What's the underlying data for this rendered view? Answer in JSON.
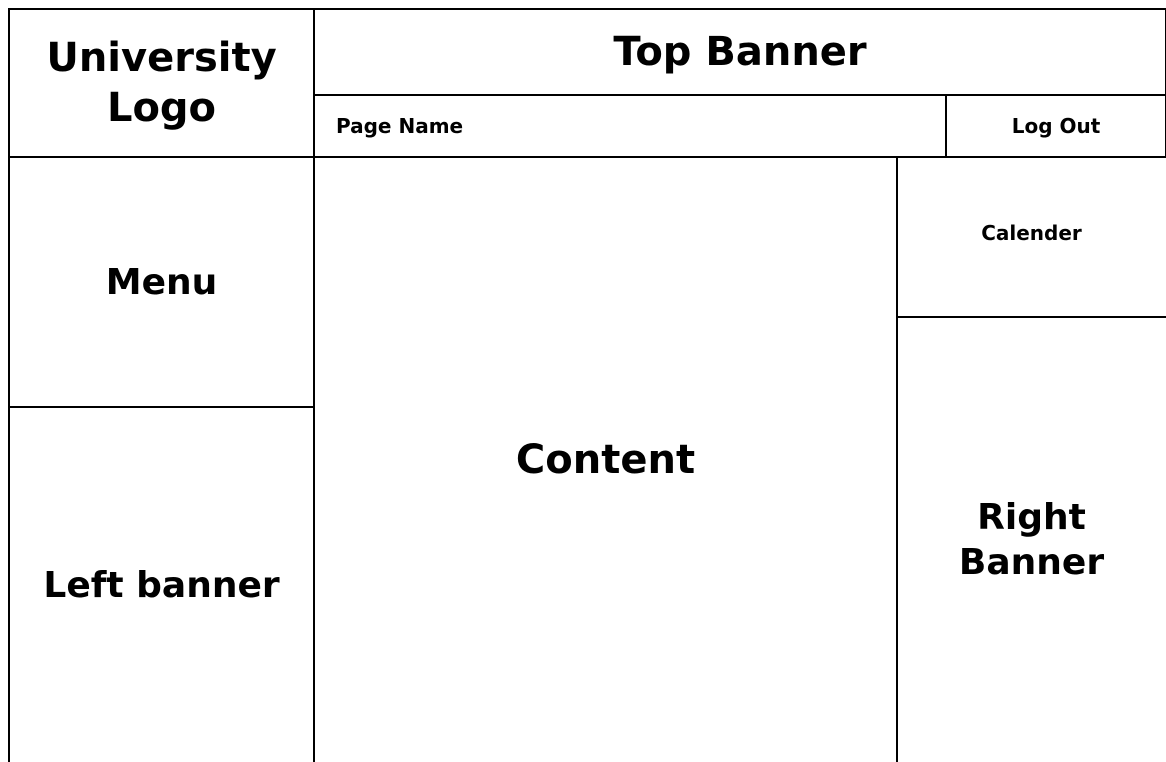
{
  "regions": {
    "university_logo": "University\nLogo",
    "top_banner": "Top Banner",
    "page_name": "Page Name",
    "log_out": "Log Out",
    "menu": "Menu",
    "left_banner": "Left banner",
    "content": "Content",
    "calender": "Calender",
    "right_banner": "Right\nBanner"
  },
  "style": {
    "border_color": "#000000",
    "background_color": "#ffffff"
  }
}
